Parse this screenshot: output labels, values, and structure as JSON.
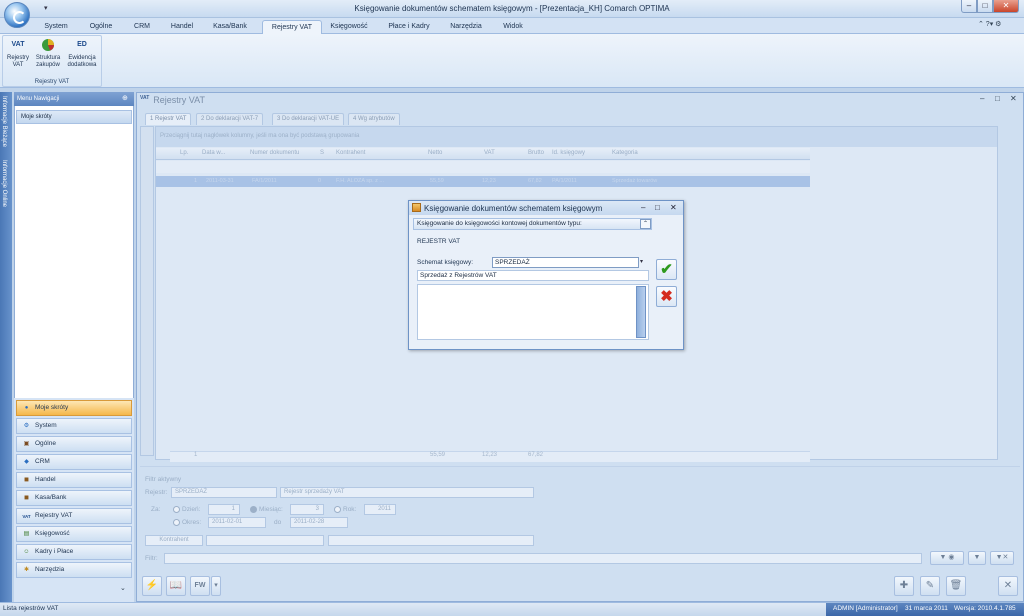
{
  "window": {
    "title": "Księgowanie dokumentów schematem księgowym - [Prezentacja_KH] Comarch OPTIMA",
    "min": "–",
    "max": "□",
    "close": "✕"
  },
  "ribbon": {
    "tabs": [
      "System",
      "Ogólne",
      "CRM",
      "Handel",
      "Kasa/Bank",
      "Rejestry VAT",
      "Księgowość",
      "Płace i Kadry",
      "Narzędzia",
      "Widok"
    ],
    "active_tab": "Rejestry VAT",
    "right_controls": "⌃ ?▾ ⚙",
    "group_label": "Rejestry VAT",
    "buttons": [
      {
        "label": "Rejestry VAT",
        "icon": "VAT"
      },
      {
        "label": "Struktura zakupów",
        "icon": "pie-chart-icon"
      },
      {
        "label": "Ewidencja dodatkowa",
        "icon": "ED"
      }
    ]
  },
  "left_strip": {
    "items": [
      "Informacje Bieżące",
      "Informacje Online"
    ]
  },
  "nav": {
    "header": "Menu Nawigacji",
    "pin": "⊕",
    "shortcuts_title": "Moje skróty",
    "items": [
      "Moje skróty",
      "System",
      "Ogólne",
      "CRM",
      "Handel",
      "Kasa/Bank",
      "Rejestry VAT",
      "Księgowość",
      "Kadry i Płace",
      "Narzędzia"
    ],
    "active": "Moje skróty",
    "scroll": "⌄"
  },
  "main": {
    "title": "Rejestry VAT",
    "title_icon": "VAT",
    "controls": [
      "–",
      "□",
      "✕"
    ],
    "tabs": [
      "1 Rejestr VAT",
      "2 Do deklaracji VAT-7",
      "3 Do deklaracji VAT-UE",
      "4 Wg atrybutów"
    ],
    "group_hint": "Przeciągnij tutaj nagłówek kolumny, jeśli ma ona być podstawą grupowania",
    "columns": [
      "Lp.",
      "Data w...",
      "Numer dokumentu",
      "S",
      "Kontrahent",
      "Netto",
      "VAT",
      "Brutto",
      "Id. księgowy",
      "Kategoria"
    ],
    "row": [
      "1",
      "2011-03-31",
      "FA/1/2011",
      "0",
      "F.H. ALOZA sp. z ...",
      "55,59",
      "12,23",
      "67,82",
      "PA/1/2011",
      "Sprzedaż towarów"
    ],
    "footer": [
      "1",
      "55,59",
      "12,23",
      "67,82"
    ]
  },
  "filter": {
    "section": "Filtr aktywny",
    "register_label": "Rejestr:",
    "register_value": "SPRZEDAŻ",
    "register_desc": "Rejestr sprzedaży VAT",
    "za_label": "Za:",
    "dzien_label": "Dzień:",
    "dzien_value": "1",
    "miesiac_label": "Miesiąc:",
    "miesiac_value": "3",
    "rok_label": "Rok:",
    "rok_value": "2011",
    "okres_label": "Okres:",
    "okres_from": "2011-02-01",
    "do_label": "do",
    "okres_to": "2011-02-28",
    "kontrahent_button": "Kontrahent",
    "filtr_label": "Filtr:"
  },
  "toolbar": {
    "buttons": [
      "⚡",
      "📖",
      "FW",
      "▾"
    ],
    "right_buttons": [
      "✚",
      "✎",
      "🗑",
      "✕"
    ]
  },
  "status": {
    "left": "Lista rejestrów VAT",
    "user": "ADMIN [Administrator]",
    "date": "31 marca 2011",
    "version": "Wersja: 2010.4.1.785"
  },
  "dialog": {
    "title": "Księgowanie dokumentów schematem księgowym",
    "controls": [
      "–",
      "□",
      "✕"
    ],
    "section": "Księgowanie do księgowości kontowej dokumentów typu:",
    "collapse": "⌃",
    "type": "REJESTR VAT",
    "schema_label": "Schemat księgowy:",
    "schema_value": "SPRZEDAŻ",
    "schema_arrow": "▾",
    "schema_desc": "Sprzedaż z Rejestrów VAT",
    "ok": "✔",
    "cancel": "✖"
  }
}
